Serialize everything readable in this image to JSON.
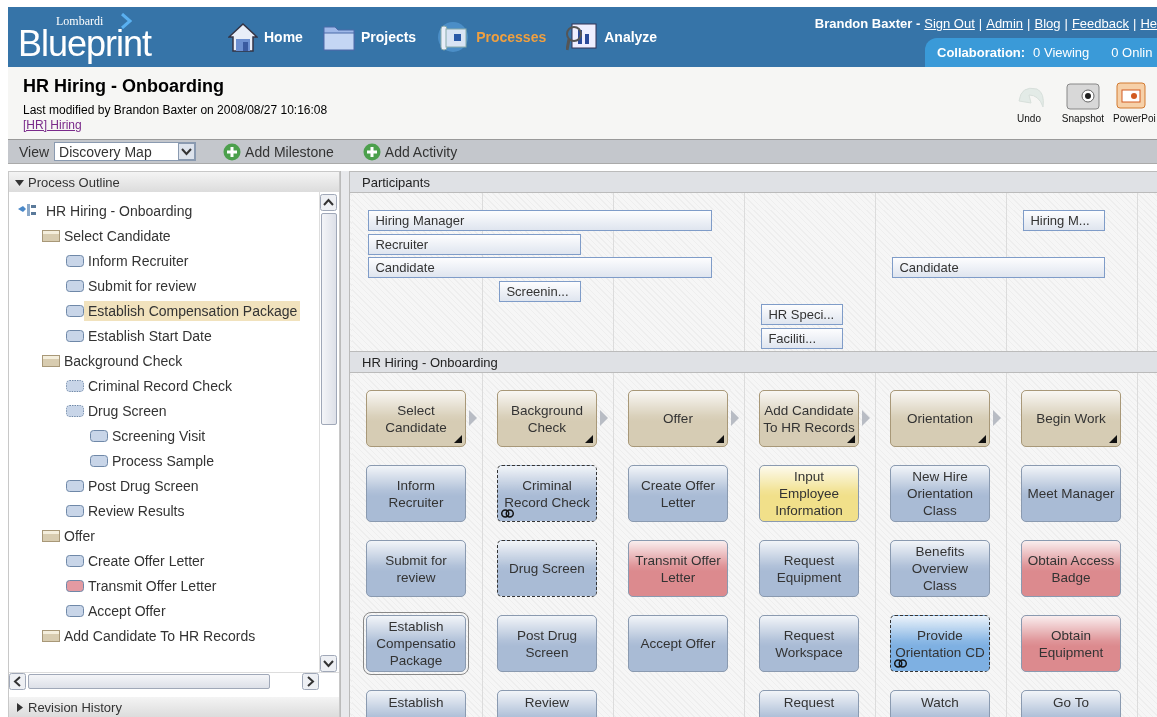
{
  "header": {
    "logo_small": "Lombardi",
    "logo": "Blueprint",
    "nav": [
      {
        "label": "Home",
        "selected": false
      },
      {
        "label": "Projects",
        "selected": false
      },
      {
        "label": "Processes",
        "selected": true
      },
      {
        "label": "Analyze",
        "selected": false
      }
    ],
    "user_line": [
      {
        "text": "Brandon Baxter -",
        "kind": "name"
      },
      {
        "text": "Sign Out",
        "kind": "link"
      },
      {
        "text": "|",
        "kind": "sep"
      },
      {
        "text": "Admin",
        "kind": "link"
      },
      {
        "text": "|",
        "kind": "sep"
      },
      {
        "text": "Blog",
        "kind": "link"
      },
      {
        "text": "|",
        "kind": "sep"
      },
      {
        "text": "Feedback",
        "kind": "link"
      },
      {
        "text": "|",
        "kind": "sep"
      },
      {
        "text": "He",
        "kind": "link"
      }
    ],
    "collaboration": {
      "label": "Collaboration:",
      "viewing": "0 Viewing",
      "online": "0 Onlin"
    }
  },
  "title_bar": {
    "title": "HR Hiring - Onboarding",
    "modified": "Last modified by Brandon Baxter on 2008/08/27 10:16:08",
    "breadcrumb": "[HR] Hiring",
    "actions": [
      {
        "label": "Undo",
        "disabled": true
      },
      {
        "label": "Snapshot",
        "disabled": false
      },
      {
        "label": "PowerPoi",
        "disabled": false
      }
    ]
  },
  "toolbar": {
    "view_label": "View",
    "view_value": "Discovery Map",
    "buttons": [
      "Add Milestone",
      "Add Activity"
    ]
  },
  "outline": {
    "title": "Process Outline",
    "expanded": true,
    "footer": {
      "title": "Revision History",
      "expanded": false
    },
    "tree": [
      {
        "label": "HR Hiring - Onboarding",
        "kind": "root",
        "selected": false,
        "children": [
          {
            "label": "Select Candidate",
            "kind": "milestone",
            "selected": false,
            "children": [
              {
                "label": "Inform Recruiter",
                "kind": "activity",
                "color": "#c8d5e8",
                "dashed": false,
                "selected": false
              },
              {
                "label": "Submit for review",
                "kind": "activity",
                "color": "#c8d5e8",
                "dashed": false,
                "selected": false
              },
              {
                "label": "Establish Compensation Package",
                "kind": "activity",
                "color": "#c8d5e8",
                "dashed": false,
                "selected": true
              },
              {
                "label": "Establish Start Date",
                "kind": "activity",
                "color": "#c8d5e8",
                "dashed": false,
                "selected": false
              }
            ]
          },
          {
            "label": "Background Check",
            "kind": "milestone",
            "selected": false,
            "children": [
              {
                "label": "Criminal Record Check",
                "kind": "activity",
                "color": "#c8d5e8",
                "dashed": true,
                "selected": false
              },
              {
                "label": "Drug Screen",
                "kind": "activity",
                "color": "#c8d5e8",
                "dashed": true,
                "selected": false,
                "children": [
                  {
                    "label": "Screening Visit",
                    "kind": "activity",
                    "color": "#c8d5e8",
                    "dashed": false,
                    "selected": false
                  },
                  {
                    "label": "Process Sample",
                    "kind": "activity",
                    "color": "#c8d5e8",
                    "dashed": false,
                    "selected": false
                  }
                ]
              },
              {
                "label": "Post Drug Screen",
                "kind": "activity",
                "color": "#c8d5e8",
                "dashed": false,
                "selected": false
              },
              {
                "label": "Review Results",
                "kind": "activity",
                "color": "#c8d5e8",
                "dashed": false,
                "selected": false
              }
            ]
          },
          {
            "label": "Offer",
            "kind": "milestone",
            "selected": false,
            "children": [
              {
                "label": "Create Offer Letter",
                "kind": "activity",
                "color": "#c8d5e8",
                "dashed": false,
                "selected": false
              },
              {
                "label": "Transmit Offer Letter",
                "kind": "activity",
                "color": "#e39aa2",
                "dashed": false,
                "selected": false
              },
              {
                "label": "Accept Offer",
                "kind": "activity",
                "color": "#c8d5e8",
                "dashed": false,
                "selected": false
              }
            ]
          },
          {
            "label": "Add Candidate To HR Records",
            "kind": "milestone",
            "selected": false
          }
        ]
      }
    ]
  },
  "map": {
    "participants_title": "Participants",
    "participants": [
      {
        "name": "Hiring Manager"
      },
      {
        "name": "Recruiter"
      },
      {
        "name": "Candidate"
      },
      {
        "name": "Screenin..."
      },
      {
        "name": "HR Speci..."
      },
      {
        "name": "Faciliti..."
      },
      {
        "name": "Hiring M..."
      },
      {
        "name": "Candidate"
      }
    ],
    "process_title": "HR Hiring - Onboarding",
    "milestones": [
      {
        "label": "Select Candidate",
        "activities": [
          {
            "label": "Inform Recruiter",
            "color": "#a9bbd5",
            "dashed": false,
            "linked": false,
            "selected": false
          },
          {
            "label": "Submit for review",
            "color": "#a9bbd5",
            "dashed": false,
            "linked": false,
            "selected": false
          },
          {
            "label": "Establish Compensatio Package",
            "color": "#a9bbd5",
            "dashed": false,
            "linked": false,
            "selected": true
          },
          {
            "label": "Establish",
            "color": "#a9bbd5",
            "dashed": false,
            "linked": false,
            "selected": false
          }
        ]
      },
      {
        "label": "Background Check",
        "activities": [
          {
            "label": "Criminal Record Check",
            "color": "#a9bbd5",
            "dashed": true,
            "linked": true,
            "selected": false
          },
          {
            "label": "Drug Screen",
            "color": "#a9bbd5",
            "dashed": true,
            "linked": false,
            "selected": false
          },
          {
            "label": "Post Drug Screen",
            "color": "#a9bbd5",
            "dashed": false,
            "linked": false,
            "selected": false
          },
          {
            "label": "Review",
            "color": "#a9bbd5",
            "dashed": false,
            "linked": false,
            "selected": false
          }
        ]
      },
      {
        "label": "Offer",
        "activities": [
          {
            "label": "Create Offer Letter",
            "color": "#a9bbd5",
            "dashed": false,
            "linked": false,
            "selected": false
          },
          {
            "label": "Transmit Offer Letter",
            "color": "#dc8a8e",
            "dashed": false,
            "linked": false,
            "selected": false
          },
          {
            "label": "Accept Offer",
            "color": "#a9bbd5",
            "dashed": false,
            "linked": false,
            "selected": false
          }
        ]
      },
      {
        "label": "Add Candidate To HR Records",
        "activities": [
          {
            "label": "Input Employee Information",
            "color": "#f1e08a",
            "dashed": false,
            "linked": false,
            "selected": false
          },
          {
            "label": "Request Equipment",
            "color": "#a9bbd5",
            "dashed": false,
            "linked": false,
            "selected": false
          },
          {
            "label": "Request Workspace",
            "color": "#a9bbd5",
            "dashed": false,
            "linked": false,
            "selected": false
          },
          {
            "label": "Request",
            "color": "#a9bbd5",
            "dashed": false,
            "linked": false,
            "selected": false
          }
        ]
      },
      {
        "label": "Orientation",
        "activities": [
          {
            "label": "New Hire Orientation Class",
            "color": "#a9bbd5",
            "dashed": false,
            "linked": false,
            "selected": false
          },
          {
            "label": "Benefits Overview Class",
            "color": "#a9bbd5",
            "dashed": false,
            "linked": false,
            "selected": false
          },
          {
            "label": "Provide Orientation CD",
            "color": "#7eb0e2",
            "dashed": true,
            "linked": true,
            "selected": false
          },
          {
            "label": "Watch",
            "color": "#a9bbd5",
            "dashed": false,
            "linked": false,
            "selected": false
          }
        ]
      },
      {
        "label": "Begin Work",
        "activities": [
          {
            "label": "Meet Manager",
            "color": "#a9bbd5",
            "dashed": false,
            "linked": false,
            "selected": false
          },
          {
            "label": "Obtain Access Badge",
            "color": "#dc8a8e",
            "dashed": false,
            "linked": false,
            "selected": false
          },
          {
            "label": "Obtain Equipment",
            "color": "#dc8a8e",
            "dashed": false,
            "linked": false,
            "selected": false
          },
          {
            "label": "Go To",
            "color": "#a9bbd5",
            "dashed": false,
            "linked": false,
            "selected": false
          }
        ]
      }
    ]
  }
}
